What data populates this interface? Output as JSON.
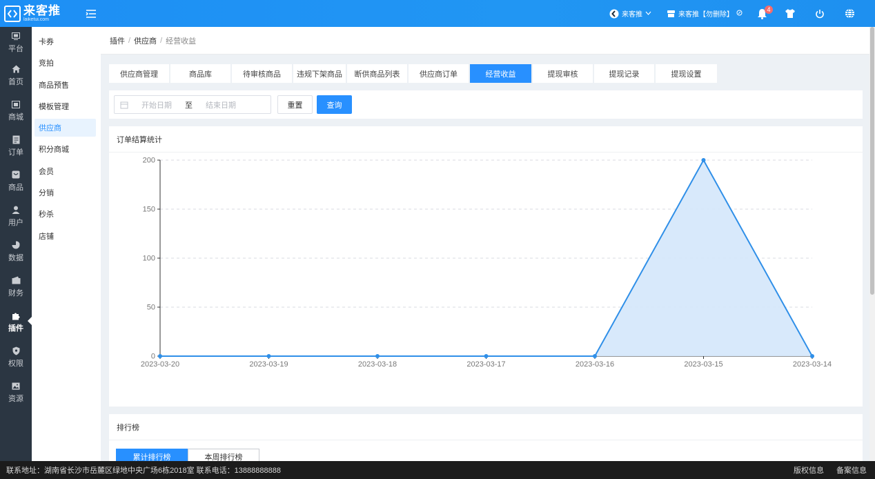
{
  "header": {
    "logo_main": "来客推",
    "logo_sub": "laiketui.com",
    "store_name": "来客推",
    "store_label": "来客推【勿删除】",
    "notification_count": "4"
  },
  "rail": [
    {
      "label": "平台",
      "icon": "platform-icon"
    },
    {
      "label": "首页",
      "icon": "home-icon"
    },
    {
      "label": "商城",
      "icon": "mall-icon"
    },
    {
      "label": "订单",
      "icon": "order-icon"
    },
    {
      "label": "商品",
      "icon": "goods-icon"
    },
    {
      "label": "用户",
      "icon": "user-icon"
    },
    {
      "label": "数据",
      "icon": "data-icon"
    },
    {
      "label": "财务",
      "icon": "finance-icon"
    },
    {
      "label": "插件",
      "icon": "plugin-icon",
      "active": true
    },
    {
      "label": "权限",
      "icon": "permission-icon"
    },
    {
      "label": "资源",
      "icon": "resource-icon"
    }
  ],
  "submenu": [
    "卡券",
    "竞拍",
    "商品预售",
    "模板管理",
    "供应商",
    "积分商城",
    "会员",
    "分销",
    "秒杀",
    "店铺"
  ],
  "submenu_active_index": 4,
  "breadcrumb": {
    "level1": "插件",
    "level2": "供应商",
    "current": "经营收益",
    "sep": "/"
  },
  "tabs": [
    {
      "label": "供应商管理"
    },
    {
      "label": "商品库"
    },
    {
      "label": "待审核商品"
    },
    {
      "label": "违规下架商品"
    },
    {
      "label": "断供商品列表"
    },
    {
      "label": "供应商订单"
    },
    {
      "label": "经营收益",
      "active": true
    },
    {
      "label": "提现审核"
    },
    {
      "label": "提现记录"
    },
    {
      "label": "提现设置"
    }
  ],
  "filter": {
    "start_placeholder": "开始日期",
    "to_label": "至",
    "end_placeholder": "结束日期",
    "reset_label": "重置",
    "query_label": "查询"
  },
  "chart_card_title": "订单结算统计",
  "chart_data": {
    "type": "area",
    "title": "",
    "xlabel": "",
    "ylabel": "",
    "x": [
      "2023-03-20",
      "2023-03-19",
      "2023-03-18",
      "2023-03-17",
      "2023-03-16",
      "2023-03-15",
      "2023-03-14"
    ],
    "series": [
      {
        "values": [
          0,
          0,
          0,
          0,
          0,
          200,
          0
        ]
      }
    ],
    "ylim": [
      0,
      200
    ],
    "yticks": [
      0,
      50,
      100,
      150,
      200
    ],
    "grid": true,
    "line_color": "#2f8fe8",
    "fill_color": "#d6e8fb"
  },
  "rank_card": {
    "title": "排行榜",
    "tab_total": "累计排行榜",
    "tab_week": "本周排行榜"
  },
  "footer": {
    "address": "联系地址：湖南省长沙市岳麓区绿地中央广场6栋2018室 联系电话：13888888888",
    "copyright": "版权信息",
    "icp": "备案信息"
  }
}
